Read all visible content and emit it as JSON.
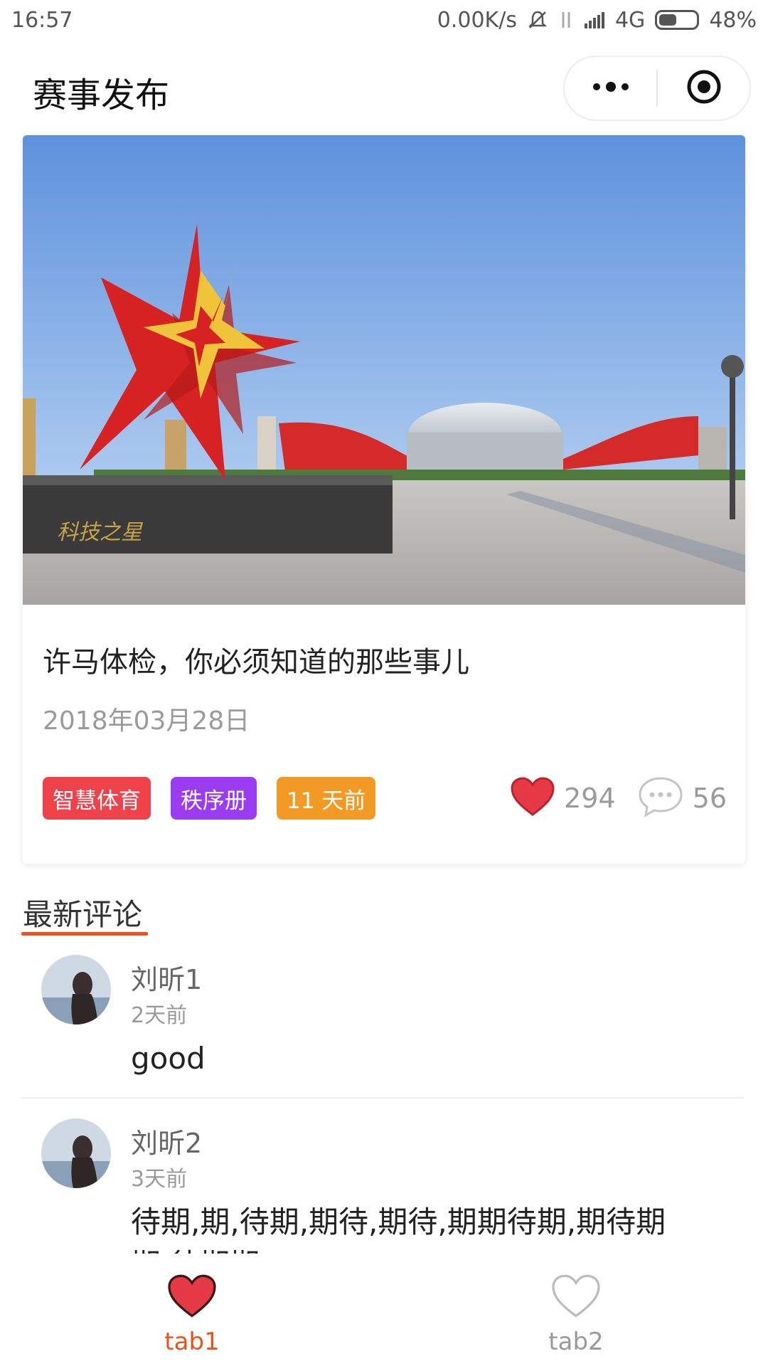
{
  "status_bar": {
    "time": "16:57",
    "net_speed": "0.00K/s",
    "network": "4G",
    "battery": "48%",
    "battery_level": 0.48
  },
  "header": {
    "title": "赛事发布",
    "more_icon": "more-dots-icon",
    "close_icon": "target-circle-icon"
  },
  "article": {
    "image_caption": "科技之星",
    "title": "许马体检，你必须知道的那些事儿",
    "date": "2018年03月28日",
    "tags": [
      {
        "label": "智慧体育",
        "color": "#f0424b"
      },
      {
        "label": "秩序册",
        "color": "#9b3cf3"
      },
      {
        "label": "11 天前",
        "color": "#f39a24"
      }
    ],
    "likes": "294",
    "comments": "56"
  },
  "comments_section": {
    "title": "最新评论",
    "accent": "#e8541e",
    "items": [
      {
        "name": "刘昕1",
        "time": "2天前",
        "text": "good"
      },
      {
        "name": "刘昕2",
        "time": "3天前",
        "text": "待期,期,待期,期待,期待,期期待期,期待期期,待期期"
      }
    ]
  },
  "tabbar": {
    "active_color": "#e8541e",
    "inactive_color": "#999999",
    "tabs": [
      {
        "label": "tab1",
        "icon": "heart-filled-icon",
        "active": true
      },
      {
        "label": "tab2",
        "icon": "heart-outline-icon",
        "active": false
      }
    ]
  }
}
